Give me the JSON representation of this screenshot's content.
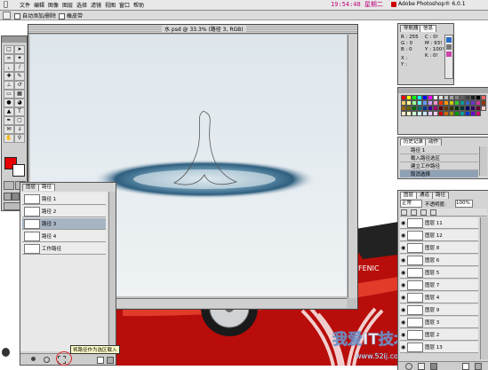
{
  "menubar": {
    "apple_icon": "apple-icon",
    "items": [
      "文件",
      "编辑",
      "图像",
      "图层",
      "选择",
      "滤镜",
      "视图",
      "窗口",
      "帮助"
    ],
    "clock": "19:54:48 星期二",
    "app_name": "Adobe Photoshop® 6.0.1"
  },
  "options_bar": {
    "options": [
      "自动添加/删除",
      "橡皮带"
    ]
  },
  "document": {
    "title": "水 psd @ 33.3% (路径 3, RGB)"
  },
  "navigator": {
    "tabs": [
      "导航器",
      "信息"
    ],
    "readouts": [
      {
        "label": "R :",
        "value": "255"
      },
      {
        "label": "G :",
        "value": "0"
      },
      {
        "label": "B :",
        "value": "0"
      },
      {
        "label": "X :",
        "value": ""
      },
      {
        "label": "Y :",
        "value": ""
      }
    ],
    "cmyk": [
      {
        "label": "C :",
        "value": "0!"
      },
      {
        "label": "M :",
        "value": "93!"
      },
      {
        "label": "Y :",
        "value": "100!"
      },
      {
        "label": "K :",
        "value": "0!"
      }
    ]
  },
  "swatches": {
    "colors": [
      "#ff0000",
      "#ffff00",
      "#00ff00",
      "#00ffff",
      "#0000ff",
      "#ff00ff",
      "#ffffff",
      "#e0e0e0",
      "#c0c0c0",
      "#a0a0a0",
      "#808080",
      "#606060",
      "#404040",
      "#202020",
      "#000000",
      "#ff6666",
      "#ffcc66",
      "#ffff99",
      "#99ff99",
      "#66ffff",
      "#6699ff",
      "#cc99ff",
      "#ff99cc",
      "#ff3300",
      "#ff9900",
      "#cccc00",
      "#33cc33",
      "#009999",
      "#3366cc",
      "#6633cc",
      "#cc3399",
      "#993300",
      "#996600",
      "#666600",
      "#006600",
      "#006666",
      "#003399",
      "#330099",
      "#990066",
      "#660000",
      "#663300",
      "#333300",
      "#003300",
      "#003333",
      "#000066",
      "#330066",
      "#660033",
      "#ffcccc",
      "#ffe5cc",
      "#ffffcc",
      "#ccffcc",
      "#ccffff",
      "#cce5ff",
      "#e5ccff",
      "#ffcce5",
      "#cc0000",
      "#cc6600",
      "#999900",
      "#009900",
      "#009999",
      "#0033cc",
      "#6600cc",
      "#cc0066"
    ]
  },
  "history": {
    "tabs": [
      "历史记录",
      "动作"
    ],
    "items": [
      "路径 1",
      "载入路径选区",
      "建立工作路径",
      "取消选择"
    ]
  },
  "layers": {
    "tabs": [
      "图层",
      "通道",
      "路径"
    ],
    "mode": "正常",
    "opacity_label": "不透明度:",
    "opacity": "100%",
    "items": [
      "图层 11",
      "图层 12",
      "图层 8",
      "图层 6",
      "图层 5",
      "图层 7",
      "图层 4",
      "图层 9",
      "图层 3",
      "图层 2",
      "图层 13"
    ]
  },
  "paths": {
    "tabs": [
      "图层",
      "路径"
    ],
    "items": [
      "路径 1",
      "路径 2",
      "路径 3",
      "路径 4",
      "工作路径"
    ],
    "selected_index": 2,
    "tooltip": "将路径作为选区载入"
  },
  "watermark": {
    "brand": "我爱IT技术网",
    "domain": "www.52ij.com"
  },
  "car": {
    "badge": "FENIC"
  }
}
